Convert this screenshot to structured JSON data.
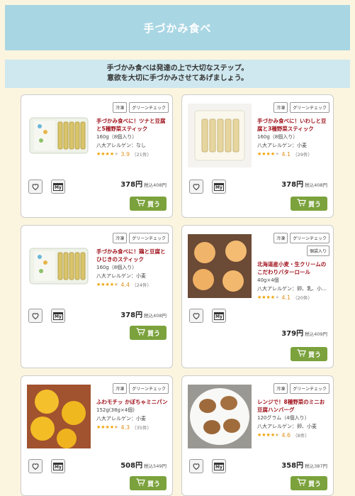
{
  "header": {
    "title": "手づかみ食べ"
  },
  "intro": {
    "line1": "手づかみ食べは発達の上で大切なステップ。",
    "line2": "意欲を大切に手づかみさせてあげましょう。"
  },
  "colors": {
    "accent": "#a9d6e3",
    "intro_bg": "#cfe8ef",
    "buy_button": "#7ba23c",
    "product_name": "#a0141e",
    "star": "#f0a000"
  },
  "labels": {
    "buy": "買う",
    "my_icon": "My",
    "tax_prefix": "税込",
    "price_unit": "円"
  },
  "products": [
    {
      "tags": [
        "冷凍",
        "グリーンチェック"
      ],
      "name": "手づかみ食べに！ツナと豆腐と5種野菜スティック",
      "weight": "160g（8個入り）",
      "allergen": "八大アレルゲン：なし",
      "rating": "3.9",
      "rating_value": 3.9,
      "reviews": "（21件）",
      "price": "378円",
      "tax_price": "税込408円",
      "image_icon": "packaged-sticks"
    },
    {
      "tags": [
        "冷凍",
        "グリーンチェック"
      ],
      "name": "手づかみ食べに！いわしと豆腐と3種野菜スティック",
      "weight": "160g（8個入り）",
      "allergen": "八大アレルゲン：小麦",
      "rating": "4.1",
      "rating_value": 4.1,
      "reviews": "（29件）",
      "price": "378円",
      "tax_price": "税込408円",
      "image_icon": "fish-sticks"
    },
    {
      "tags": [
        "冷凍",
        "グリーンチェック"
      ],
      "name": "手づかみ食べに！鶏と豆腐とひじきのスティック",
      "weight": "160g（8個入り）",
      "allergen": "八大アレルゲン：小麦",
      "rating": "4.4",
      "rating_value": 4.4,
      "reviews": "（24件）",
      "price": "378円",
      "tax_price": "税込408円",
      "image_icon": "packaged-sticks"
    },
    {
      "tags": [
        "冷凍",
        "グリーンチェック",
        "個袋入り"
      ],
      "name": "北海道産小麦・生クリームのこだわりバターロール",
      "weight": "40g×4個",
      "allergen": "八大アレルゲン：卵、乳、小…",
      "rating": "4.1",
      "rating_value": 4.1,
      "reviews": "（20件）",
      "price": "379円",
      "tax_price": "税込409円",
      "image_icon": "butter-rolls"
    },
    {
      "tags": [
        "冷凍",
        "グリーンチェック"
      ],
      "name": "ふわモチッ かぼちゃミニパン",
      "weight": "152g(38g×4個)",
      "allergen": "八大アレルゲン：小麦",
      "rating": "4.3",
      "rating_value": 4.3,
      "reviews": "（35件）",
      "price": "508円",
      "tax_price": "税込549円",
      "image_icon": "pumpkin-buns"
    },
    {
      "tags": [
        "冷凍",
        "グリーンチェック"
      ],
      "name": "レンジで！8種野菜のミニお豆腐ハンバーグ",
      "weight": "120グラム（4個入り）",
      "allergen": "八大アレルゲン：卵、小麦",
      "rating": "4.6",
      "rating_value": 4.6,
      "reviews": "（8件）",
      "price": "358円",
      "tax_price": "税込387円",
      "image_icon": "tofu-hamburg"
    }
  ]
}
